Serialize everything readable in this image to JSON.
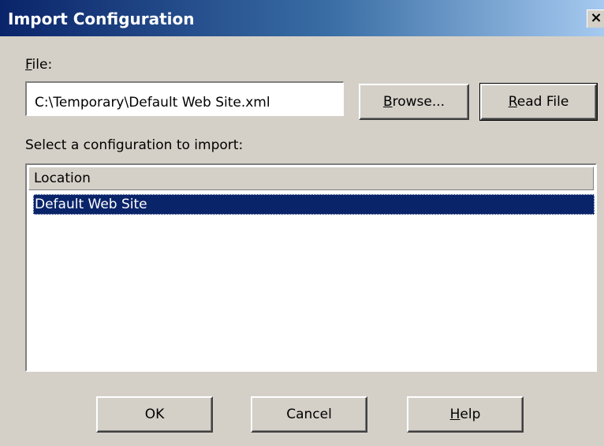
{
  "window": {
    "title": "Import Configuration",
    "close_glyph": "×",
    "close_icon": "close-icon"
  },
  "file": {
    "label_accel": "F",
    "label_rest": "ile:",
    "value": "C:\\Temporary\\Default Web Site.xml"
  },
  "buttons": {
    "browse_accel": "B",
    "browse_rest": "rowse...",
    "readfile_accel": "R",
    "readfile_rest": "ead File",
    "ok": "OK",
    "cancel": "Cancel",
    "help_accel": "H",
    "help_rest": "elp"
  },
  "prompt": "Select a configuration to import:",
  "list": {
    "columns": [
      "Location"
    ],
    "rows": [
      {
        "location": "Default Web Site",
        "selected": true
      }
    ]
  },
  "colors": {
    "title_bar_start": "#0a246a",
    "selection": "#0a246a",
    "face": "#d4d0c8"
  }
}
